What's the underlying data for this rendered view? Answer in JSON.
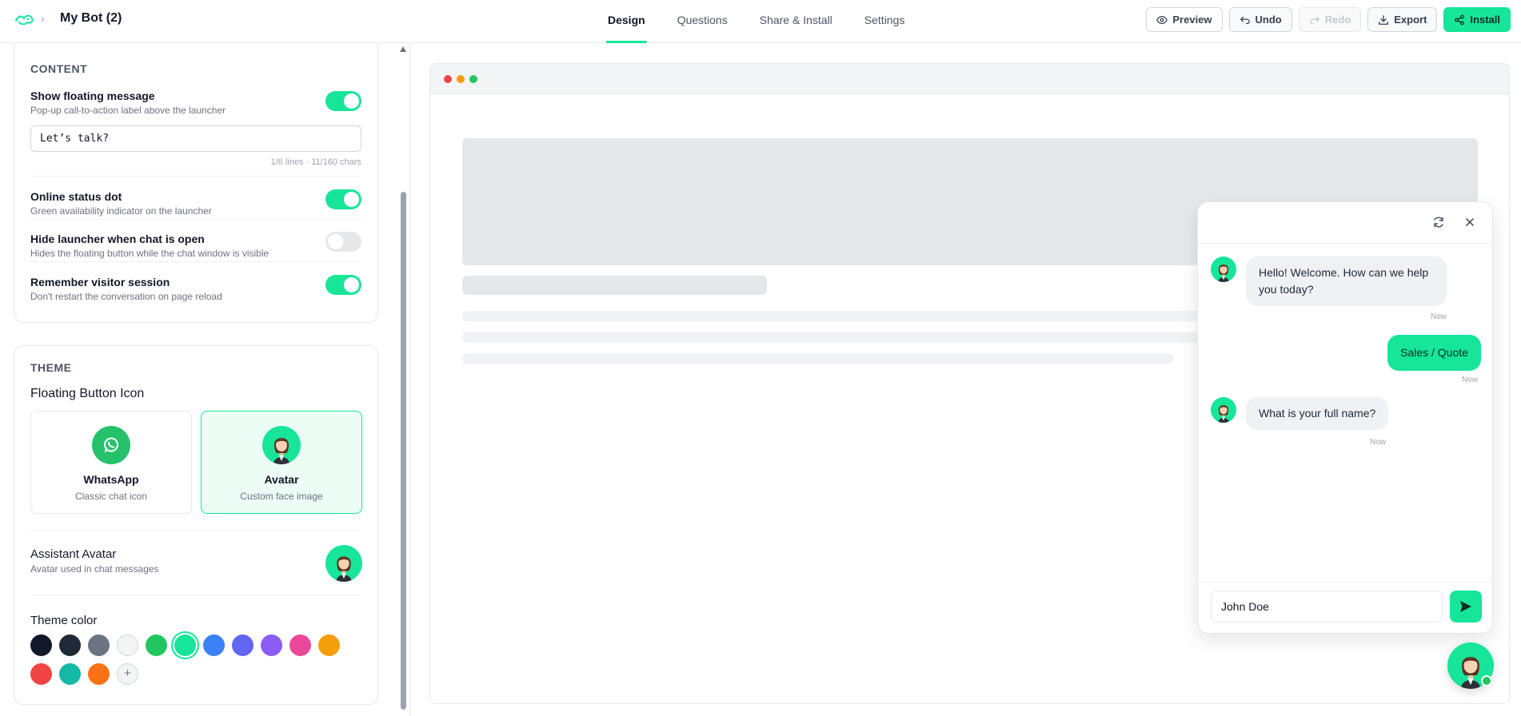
{
  "app": {
    "bot_name": "My Bot (2)",
    "breadcrumb_sep": "›"
  },
  "tabs": [
    {
      "label": "Design",
      "active": true
    },
    {
      "label": "Questions",
      "active": false
    },
    {
      "label": "Share & Install",
      "active": false
    },
    {
      "label": "Settings",
      "active": false
    }
  ],
  "toolbar": {
    "preview": "Preview",
    "undo": "Undo",
    "redo": "Redo",
    "export": "Export",
    "install": "Install"
  },
  "content": {
    "title": "CONTENT",
    "floating_message": {
      "title": "Show floating message",
      "sub": "Pop-up call-to-action label above the launcher",
      "enabled": true,
      "value": "Let’s talk?",
      "count": "1/6 lines · 11/160 chars"
    },
    "online_dot": {
      "title": "Online status dot",
      "sub": "Green availability indicator on the launcher",
      "enabled": true
    },
    "hide_launcher": {
      "title": "Hide launcher when chat is open",
      "sub": "Hides the floating button while the chat window is visible",
      "enabled": false
    },
    "remember_session": {
      "title": "Remember visitor session",
      "sub": "Don't restart the conversation on page reload",
      "enabled": true
    }
  },
  "theme": {
    "title": "THEME",
    "floating_icon_label": "Floating Button Icon",
    "options": [
      {
        "title": "WhatsApp",
        "sub": "Classic chat icon",
        "icon": "whatsapp-icon",
        "selected": false
      },
      {
        "title": "Avatar",
        "sub": "Custom face image",
        "icon": "avatar-icon",
        "selected": true
      }
    ],
    "assistant_avatar": {
      "title": "Assistant Avatar",
      "sub": "Avatar used in chat messages"
    },
    "color_label": "Theme color",
    "colors": [
      "#111827",
      "#1f2937",
      "#6b7280",
      "#f3f4f6",
      "#22c55e",
      "#16e59a",
      "#3b82f6",
      "#6366f1",
      "#8b5cf6",
      "#ec4899",
      "#f59e0b",
      "#ef4444",
      "#14b8a6",
      "#f97316"
    ],
    "selected_color": "#16e59a",
    "add_color": "+"
  },
  "chat": {
    "messages": [
      {
        "from": "bot",
        "text": "Hello! Welcome. How can we help you today?",
        "time": "Now"
      },
      {
        "from": "user",
        "text": "Sales / Quote",
        "time": "Now"
      },
      {
        "from": "bot",
        "text": "What is your full name?",
        "time": "Now"
      }
    ],
    "input_value": "John Doe"
  },
  "colors": {
    "accent": "#16e59a",
    "browser_dots": [
      "#ef4444",
      "#f59e0b",
      "#22c55e"
    ]
  }
}
